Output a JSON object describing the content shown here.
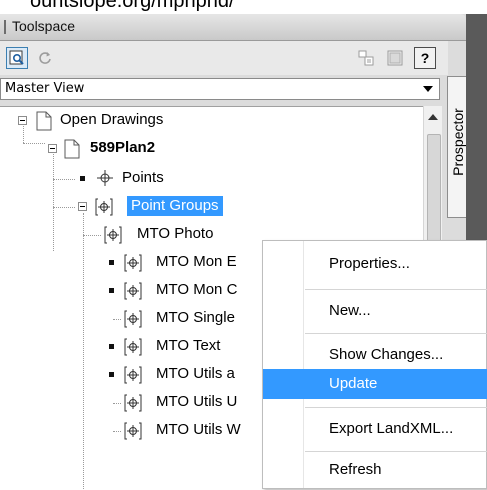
{
  "caption": {
    "text": "ountslope.org/mprlpnd/"
  },
  "window": {
    "title": "Toolspace"
  },
  "toolbar": {
    "buttons": [
      "magnifier-icon",
      "refresh-icon",
      "properties-icon",
      "item-view-icon",
      "help-icon"
    ],
    "help_label": "?"
  },
  "view_select": {
    "value": "Master View"
  },
  "side_tab": {
    "label": "Prospector"
  },
  "tree": {
    "open_drawings": "Open Drawings",
    "drawing": "589Plan2",
    "points": "Points",
    "point_groups": "Point Groups",
    "children": [
      "MTO Photo",
      "MTO Mon E",
      "MTO Mon C",
      "MTO Single",
      "MTO Text",
      "MTO Utils a",
      "MTO Utils U",
      "MTO Utils W"
    ]
  },
  "context_menu": {
    "items": [
      "Properties...",
      "New...",
      "Show Changes...",
      "Update",
      "Export LandXML...",
      "Refresh"
    ],
    "highlighted": "Update"
  },
  "colors": {
    "selection": "#3399ff",
    "chrome": "#dcdcdc",
    "dark_edge": "#5a5a5a"
  }
}
